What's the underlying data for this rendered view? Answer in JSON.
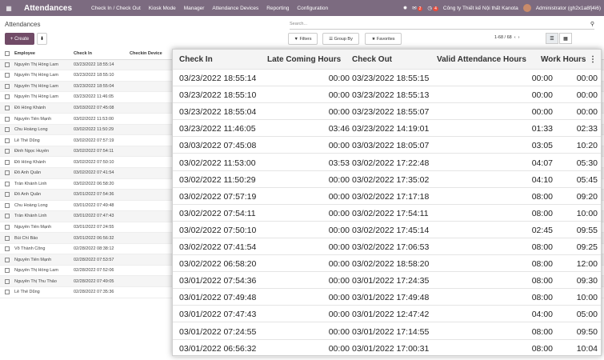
{
  "topbar": {
    "brand": "Attendances",
    "menus": [
      "Check In / Check Out",
      "Kiosk Mode",
      "Manager",
      "Attendance Devices",
      "Reporting",
      "Configuration"
    ],
    "chat_count": "2",
    "activity_count": "4",
    "company": "Công ty Thiết kế Nội thất Kanota",
    "user": "Administrator (gh2x1a8fj4i6)"
  },
  "control": {
    "title": "Attendances",
    "search_placeholder": "Search...",
    "create_label": "Create",
    "filters_label": "Filters",
    "groupby_label": "Group By",
    "favorites_label": "Favorites",
    "pager": "1-68 / 68"
  },
  "bg_table": {
    "headers": [
      "Employee",
      "Check In",
      "Checkin Device"
    ],
    "rows": [
      [
        "Nguyễn Thị Hồng Lam",
        "03/23/2022 18:55:14"
      ],
      [
        "Nguyễn Thị Hồng Lam",
        "03/23/2022 18:55:10"
      ],
      [
        "Nguyễn Thị Hồng Lam",
        "03/23/2022 18:55:04"
      ],
      [
        "Nguyễn Thị Hồng Lam",
        "03/23/2022 11:46:05"
      ],
      [
        "Đỗ Hồng Khánh",
        "03/03/2022 07:45:08"
      ],
      [
        "Nguyễn Tiến Mạnh",
        "03/02/2022 11:53:00"
      ],
      [
        "Chu Hoàng Long",
        "03/02/2022 11:50:29"
      ],
      [
        "Lê Thế Dũng",
        "03/02/2022 07:57:19"
      ],
      [
        "Đinh Ngọc Huyền",
        "03/02/2022 07:54:11"
      ],
      [
        "Đỗ Hồng Khánh",
        "03/02/2022 07:50:10"
      ],
      [
        "Đỗ Anh Quân",
        "03/02/2022 07:41:54"
      ],
      [
        "Trần Khánh Linh",
        "03/02/2022 06:58:20"
      ],
      [
        "Đỗ Anh Quân",
        "03/01/2022 07:54:36"
      ],
      [
        "Chu Hoàng Long",
        "03/01/2022 07:49:48"
      ],
      [
        "Trần Khánh Linh",
        "03/01/2022 07:47:43"
      ],
      [
        "Nguyễn Tiến Mạnh",
        "03/01/2022 07:24:55"
      ],
      [
        "Bùi Chí Bảo",
        "03/01/2022 06:56:32"
      ],
      [
        "Võ Thành Công",
        "02/28/2022 08:38:12"
      ],
      [
        "Nguyễn Tiến Mạnh",
        "02/28/2022 07:53:57"
      ],
      [
        "Nguyễn Thị Hồng Lam",
        "02/28/2022 07:52:06"
      ],
      [
        "Nguyễn Thị Thu Thảo",
        "02/28/2022 07:49:05"
      ],
      [
        "Lê Thế Dũng",
        "02/28/2022 07:35:36"
      ]
    ]
  },
  "zoom_table": {
    "headers": [
      "Check In",
      "Late Coming Hours",
      "Check Out",
      "Valid Attendance Hours",
      "Work Hours"
    ],
    "rows": [
      [
        "03/23/2022 18:55:14",
        "00:00",
        "03/23/2022 18:55:15",
        "00:00",
        "00:00"
      ],
      [
        "03/23/2022 18:55:10",
        "00:00",
        "03/23/2022 18:55:13",
        "00:00",
        "00:00"
      ],
      [
        "03/23/2022 18:55:04",
        "00:00",
        "03/23/2022 18:55:07",
        "00:00",
        "00:00"
      ],
      [
        "03/23/2022 11:46:05",
        "03:46",
        "03/23/2022 14:19:01",
        "01:33",
        "02:33"
      ],
      [
        "03/03/2022 07:45:08",
        "00:00",
        "03/03/2022 18:05:07",
        "03:05",
        "10:20"
      ],
      [
        "03/02/2022 11:53:00",
        "03:53",
        "03/02/2022 17:22:48",
        "04:07",
        "05:30"
      ],
      [
        "03/02/2022 11:50:29",
        "00:00",
        "03/02/2022 17:35:02",
        "04:10",
        "05:45"
      ],
      [
        "03/02/2022 07:57:19",
        "00:00",
        "03/02/2022 17:17:18",
        "08:00",
        "09:20"
      ],
      [
        "03/02/2022 07:54:11",
        "00:00",
        "03/02/2022 17:54:11",
        "08:00",
        "10:00"
      ],
      [
        "03/02/2022 07:50:10",
        "00:00",
        "03/02/2022 17:45:14",
        "02:45",
        "09:55"
      ],
      [
        "03/02/2022 07:41:54",
        "00:00",
        "03/02/2022 17:06:53",
        "08:00",
        "09:25"
      ],
      [
        "03/02/2022 06:58:20",
        "00:00",
        "03/02/2022 18:58:20",
        "08:00",
        "12:00"
      ],
      [
        "03/01/2022 07:54:36",
        "00:00",
        "03/01/2022 17:24:35",
        "08:00",
        "09:30"
      ],
      [
        "03/01/2022 07:49:48",
        "00:00",
        "03/01/2022 17:49:48",
        "08:00",
        "10:00"
      ],
      [
        "03/01/2022 07:47:43",
        "00:00",
        "03/01/2022 12:47:42",
        "04:00",
        "05:00"
      ],
      [
        "03/01/2022 07:24:55",
        "00:00",
        "03/01/2022 17:14:55",
        "08:00",
        "09:50"
      ],
      [
        "03/01/2022 06:56:32",
        "00:00",
        "03/01/2022 17:00:31",
        "08:00",
        "10:04"
      ]
    ]
  }
}
